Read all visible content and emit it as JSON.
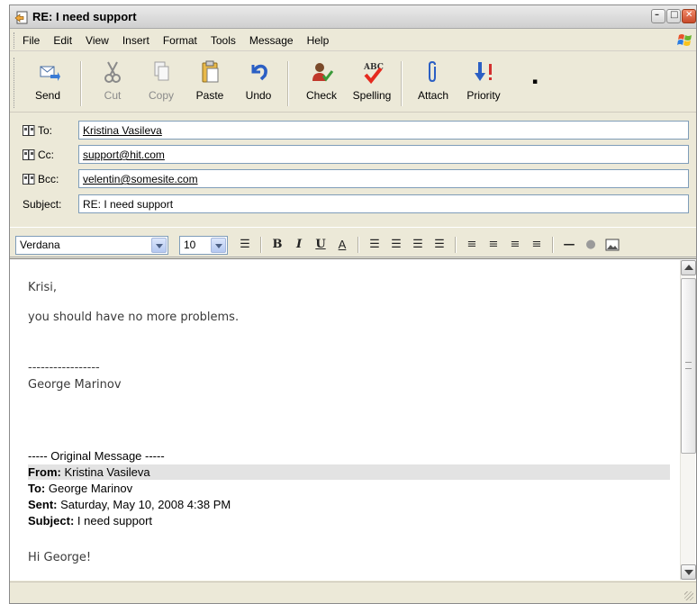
{
  "window": {
    "title": "RE: I need support"
  },
  "menu": [
    "File",
    "Edit",
    "View",
    "Insert",
    "Format",
    "Tools",
    "Message",
    "Help"
  ],
  "toolbar": {
    "send": "Send",
    "cut": "Cut",
    "copy": "Copy",
    "paste": "Paste",
    "undo": "Undo",
    "check": "Check",
    "spelling": "Spelling",
    "attach": "Attach",
    "priority": "Priority"
  },
  "headers": {
    "to_label": "To:",
    "to_value": "Kristina Vasileva",
    "cc_label": "Cc:",
    "cc_value": "support@hit.com",
    "bcc_label": "Bcc:",
    "bcc_value": "velentin@somesite.com",
    "subject_label": "Subject:",
    "subject_value": "RE: I need support"
  },
  "format": {
    "font": "Verdana",
    "size": "10"
  },
  "message": {
    "greeting": "Krisi,",
    "line1": "you should have no more problems.",
    "sig_sep": "-----------------",
    "signature": "George Marinov",
    "orig_header": "----- Original Message -----",
    "from_label": "From:",
    "from_value": "Kristina Vasileva",
    "to_label": "To:",
    "to_value": "George Marinov",
    "sent_label": "Sent:",
    "sent_value": "Saturday, May 10, 2008 4:38 PM",
    "subject_label": "Subject:",
    "subject_value": "I need support",
    "orig_greeting": "Hi George!"
  },
  "colors": {
    "chrome": "#ece9d8",
    "field_border": "#7f9db9",
    "highlight": "#e3e3e3"
  }
}
